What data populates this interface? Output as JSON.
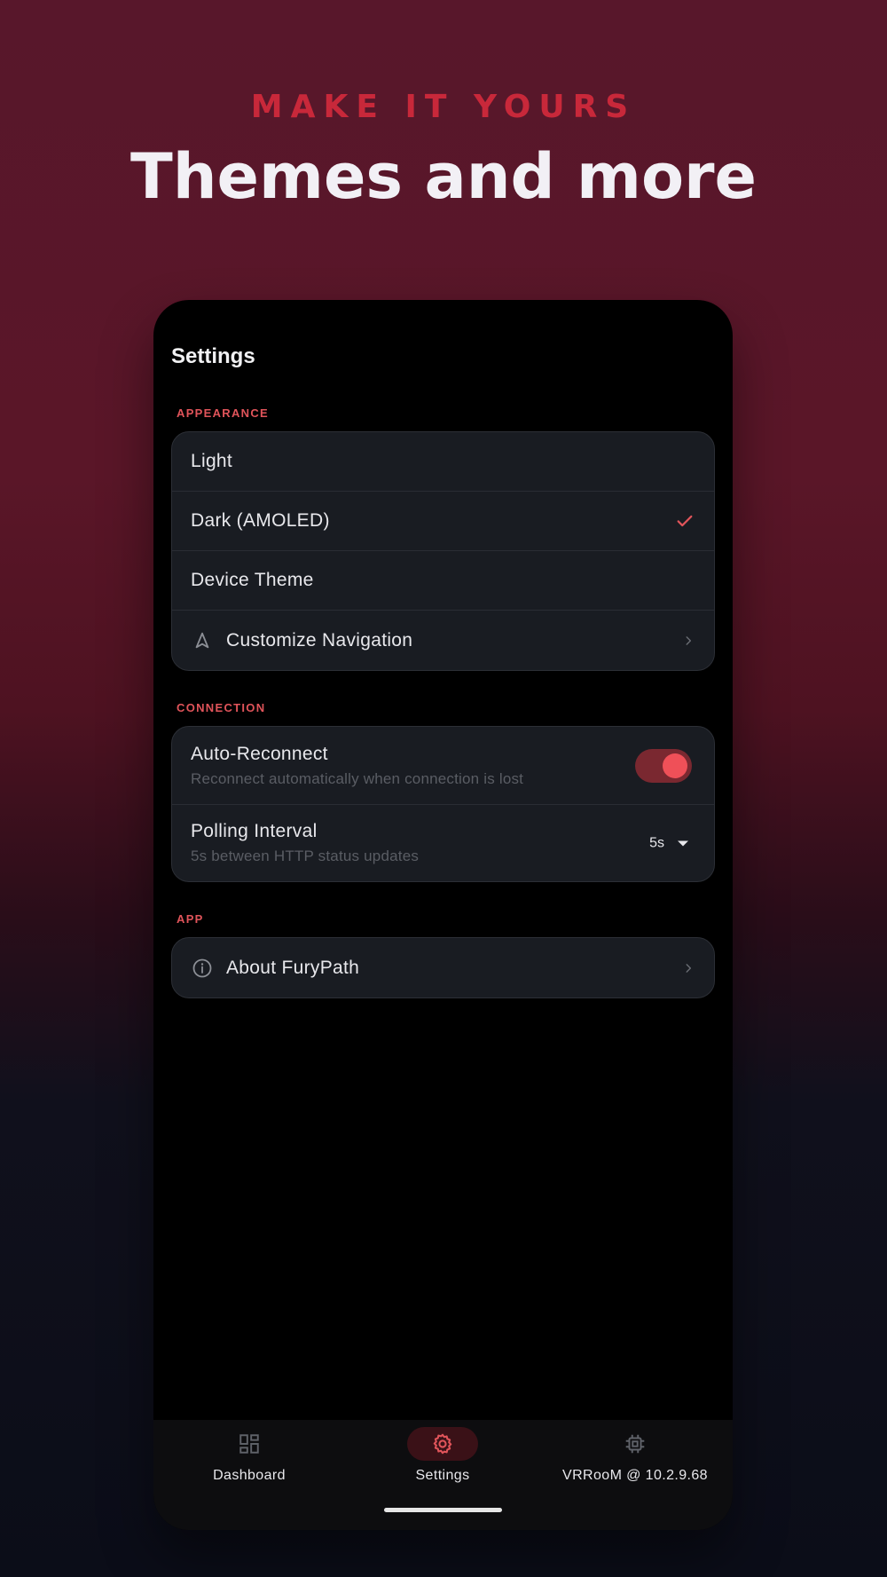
{
  "hero": {
    "eyebrow": "MAKE IT YOURS",
    "title": "Themes and more"
  },
  "screen": {
    "title": "Settings"
  },
  "appearance": {
    "section_label": "APPEARANCE",
    "items": [
      {
        "label": "Light",
        "selected": false
      },
      {
        "label": "Dark (AMOLED)",
        "selected": true
      },
      {
        "label": "Device Theme",
        "selected": false
      },
      {
        "label": "Customize Navigation",
        "icon": "navigation-arrow-icon"
      }
    ]
  },
  "connection": {
    "section_label": "CONNECTION",
    "auto_reconnect": {
      "label": "Auto-Reconnect",
      "description": "Reconnect automatically when connection is lost",
      "enabled": true
    },
    "polling": {
      "label": "Polling Interval",
      "description": "5s between HTTP status updates",
      "value": "5s"
    }
  },
  "app": {
    "section_label": "APP",
    "about_label": "About FuryPath"
  },
  "nav": {
    "items": [
      {
        "label": "Dashboard",
        "icon": "dashboard-icon",
        "active": false
      },
      {
        "label": "Settings",
        "icon": "gear-icon",
        "active": true
      },
      {
        "label": "VRRooM @ 10.2.9.68",
        "icon": "chip-icon",
        "active": false
      }
    ]
  },
  "colors": {
    "accent": "#e0545a",
    "toggle_track": "#7a2830",
    "toggle_knob": "#ef5058",
    "card_bg": "#191c22",
    "eyebrow": "#c8283a"
  }
}
